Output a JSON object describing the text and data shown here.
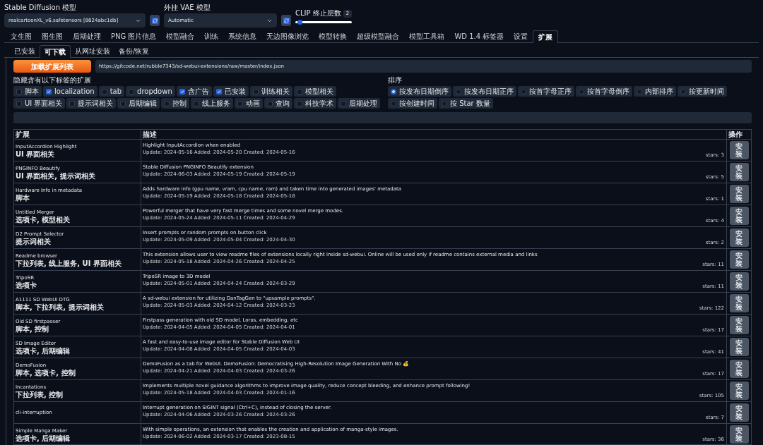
{
  "model_selectors": [
    {
      "label": "Stable Diffusion 模型",
      "value": "realcartoonXL_v6.safetensors [8824abc1db]"
    },
    {
      "label": "外挂 VAE 模型",
      "value": "Automatic"
    }
  ],
  "clip": {
    "label": "CLIP 终止层数",
    "value": "2",
    "level": 0.08
  },
  "tabs": [
    {
      "label": "文生图",
      "selected": false
    },
    {
      "label": "图生图",
      "selected": false
    },
    {
      "label": "后期处理",
      "selected": false
    },
    {
      "label": "PNG 图片信息",
      "selected": false
    },
    {
      "label": "模型融合",
      "selected": false
    },
    {
      "label": "训练",
      "selected": false
    },
    {
      "label": "系统信息",
      "selected": false
    },
    {
      "label": "无边图像浏览",
      "selected": false
    },
    {
      "label": "模型转换",
      "selected": false
    },
    {
      "label": "超级模型融合",
      "selected": false
    },
    {
      "label": "模型工具箱",
      "selected": false
    },
    {
      "label": "WD 1.4 标签器",
      "selected": false
    },
    {
      "label": "设置",
      "selected": false
    },
    {
      "label": "扩展",
      "selected": true
    }
  ],
  "sub_tabs": [
    {
      "label": "已安装",
      "selected": false
    },
    {
      "label": "可下载",
      "selected": true
    },
    {
      "label": "从网址安装",
      "selected": false
    },
    {
      "label": "备份/恢复",
      "selected": false
    }
  ],
  "load_button": "加载扩展列表",
  "url_field": {
    "value": "https://gitcode.net/rubble7343/sd-webui-extensions/raw/master/index.json"
  },
  "hide_filters": {
    "label": "隐藏含有以下标签的扩展",
    "options": [
      {
        "label": "脚本",
        "checked": false
      },
      {
        "label": "localization",
        "checked": true
      },
      {
        "label": "tab",
        "checked": false
      },
      {
        "label": "dropdown",
        "checked": false
      },
      {
        "label": "含广告",
        "checked": true
      },
      {
        "label": "已安装",
        "checked": true
      },
      {
        "label": "训练相关",
        "checked": false
      },
      {
        "label": "模型相关",
        "checked": false
      },
      {
        "label": "UI 界面相关",
        "checked": false
      },
      {
        "label": "提示词相关",
        "checked": false
      },
      {
        "label": "后期编辑",
        "checked": false
      },
      {
        "label": "控制",
        "checked": false
      },
      {
        "label": "线上服务",
        "checked": false
      },
      {
        "label": "动画",
        "checked": false
      },
      {
        "label": "查询",
        "checked": false
      },
      {
        "label": "科技学术",
        "checked": false
      },
      {
        "label": "后期处理",
        "checked": false
      }
    ]
  },
  "sort": {
    "label": "排序",
    "options": [
      {
        "label": "按发布日期倒序",
        "selected": true
      },
      {
        "label": "按发布日期正序",
        "selected": false
      },
      {
        "label": "按首字母正序",
        "selected": false
      },
      {
        "label": "按首字母倒序",
        "selected": false
      },
      {
        "label": "内部排序",
        "selected": false
      },
      {
        "label": "按更新时间",
        "selected": false
      },
      {
        "label": "按创建时间",
        "selected": false
      },
      {
        "label": "按 Star 数量",
        "selected": false
      }
    ]
  },
  "table": {
    "columns": [
      "扩展",
      "描述",
      "操作"
    ],
    "rows": [
      {
        "name": "InputAccordion Highlight",
        "tags": "UI 界面相关",
        "description": "Highlight InputAccordion when enabled",
        "dates": "Update: 2024-05-16 Added: 2024-05-20 Created: 2024-05-16",
        "stars": "stars: 3",
        "action": "安装"
      },
      {
        "name": "PNGINFO Beautify",
        "tags": "UI 界面相关, 提示词相关",
        "description": "Stable Diffusion PNGINFO Beautify extension",
        "dates": "Update: 2024-06-03 Added: 2024-05-19 Created: 2024-05-19",
        "stars": "stars: 5",
        "action": "安装"
      },
      {
        "name": "Hardware Info in metadata",
        "tags": "脚本",
        "description": "Adds hardware info (gpu name, vram, cpu name, ram) and taken time into generated images' metadata",
        "dates": "Update: 2024-05-19 Added: 2024-05-18 Created: 2024-05-18",
        "stars": "stars: 1",
        "action": "安装"
      },
      {
        "name": "Untitled Merger",
        "tags": "选项卡, 模型相关",
        "description": "Powerful merger that have very fast merge times and some novel merge modes.",
        "dates": "Update: 2024-05-24 Added: 2024-05-11 Created: 2024-04-29",
        "stars": "stars: 4",
        "action": "安装"
      },
      {
        "name": "D2 Prompt Selector",
        "tags": "提示词相关",
        "description": "Insert prompts or random prompts on button click",
        "dates": "Update: 2024-05-09 Added: 2024-05-04 Created: 2024-04-30",
        "stars": "stars: 2",
        "action": "安装"
      },
      {
        "name": "Readme browser",
        "tags": "下拉列表, 线上服务, UI 界面相关",
        "description": "This extension allows user to view readme files of extensions locally right inside sd-webui. Online will be used only if readme contains external media and links",
        "dates": "Update: 2024-05-18 Added: 2024-04-26 Created: 2024-04-25",
        "stars": "stars: 11",
        "action": "安装"
      },
      {
        "name": "TripoSR",
        "tags": "选项卡",
        "description": "TripoSR image to 3D model",
        "dates": "Update: 2024-05-01 Added: 2024-04-24 Created: 2024-03-29",
        "stars": "stars: 11",
        "action": "安装"
      },
      {
        "name": "A1111 SD WebUI DTG",
        "tags": "脚本, 下拉列表, 提示词相关",
        "description": "A sd-webui extension for utilizing DanTagGen to \"upsample prompts\".",
        "dates": "Update: 2024-05-03 Added: 2024-04-12 Created: 2024-03-23",
        "stars": "stars: 122",
        "action": "安装"
      },
      {
        "name": "Old SD firstpasser",
        "tags": "脚本, 控制",
        "description": "Firstpass generation with old SD model, Loras, embedding, etc",
        "dates": "Update: 2024-04-05 Added: 2024-04-05 Created: 2024-04-01",
        "stars": "stars: 17",
        "action": "安装"
      },
      {
        "name": "SD Image Editor",
        "tags": "选项卡, 后期编辑",
        "description": "A fast and easy-to-use image editor for Stable Diffusion Web UI",
        "dates": "Update: 2024-04-08 Added: 2024-04-05 Created: 2024-04-03",
        "stars": "stars: 41",
        "action": "安装"
      },
      {
        "name": "DemoFusion",
        "tags": "脚本, 选项卡, 控制",
        "description": "DemoFusion as a tab for WebUI. DemoFusion: Democratising High-Resolution Image Generation With No 💰",
        "dates": "Update: 2024-04-21 Added: 2024-04-03 Created: 2024-03-26",
        "stars": "stars: 17",
        "action": "安装"
      },
      {
        "name": "Incantations",
        "tags": "下拉列表, 控制",
        "description": "Implements multiple novel guidance algorithms to improve image quality, reduce concept bleeding, and enhance prompt following!",
        "dates": "Update: 2024-05-18 Added: 2024-04-03 Created: 2024-01-16",
        "stars": "stars: 105",
        "action": "安装"
      },
      {
        "name": "cli-interruption",
        "description": "Interrupt generation on SIGINT signal (Ctrl+C), instead of closing the server.",
        "dates": "Update: 2024-04-06 Added: 2024-03-26 Created: 2024-03-26",
        "stars": "stars: 7",
        "action": "安装"
      },
      {
        "name": "Simple Manga Maker",
        "tags": "选项卡, 后期编辑",
        "description": "With simple operations, an extension that enables the creation and application of manga-style images.",
        "dates": "Update: 2024-06-02 Added: 2024-03-17 Created: 2023-08-15",
        "stars": "stars: 36",
        "action": "安装"
      }
    ]
  }
}
